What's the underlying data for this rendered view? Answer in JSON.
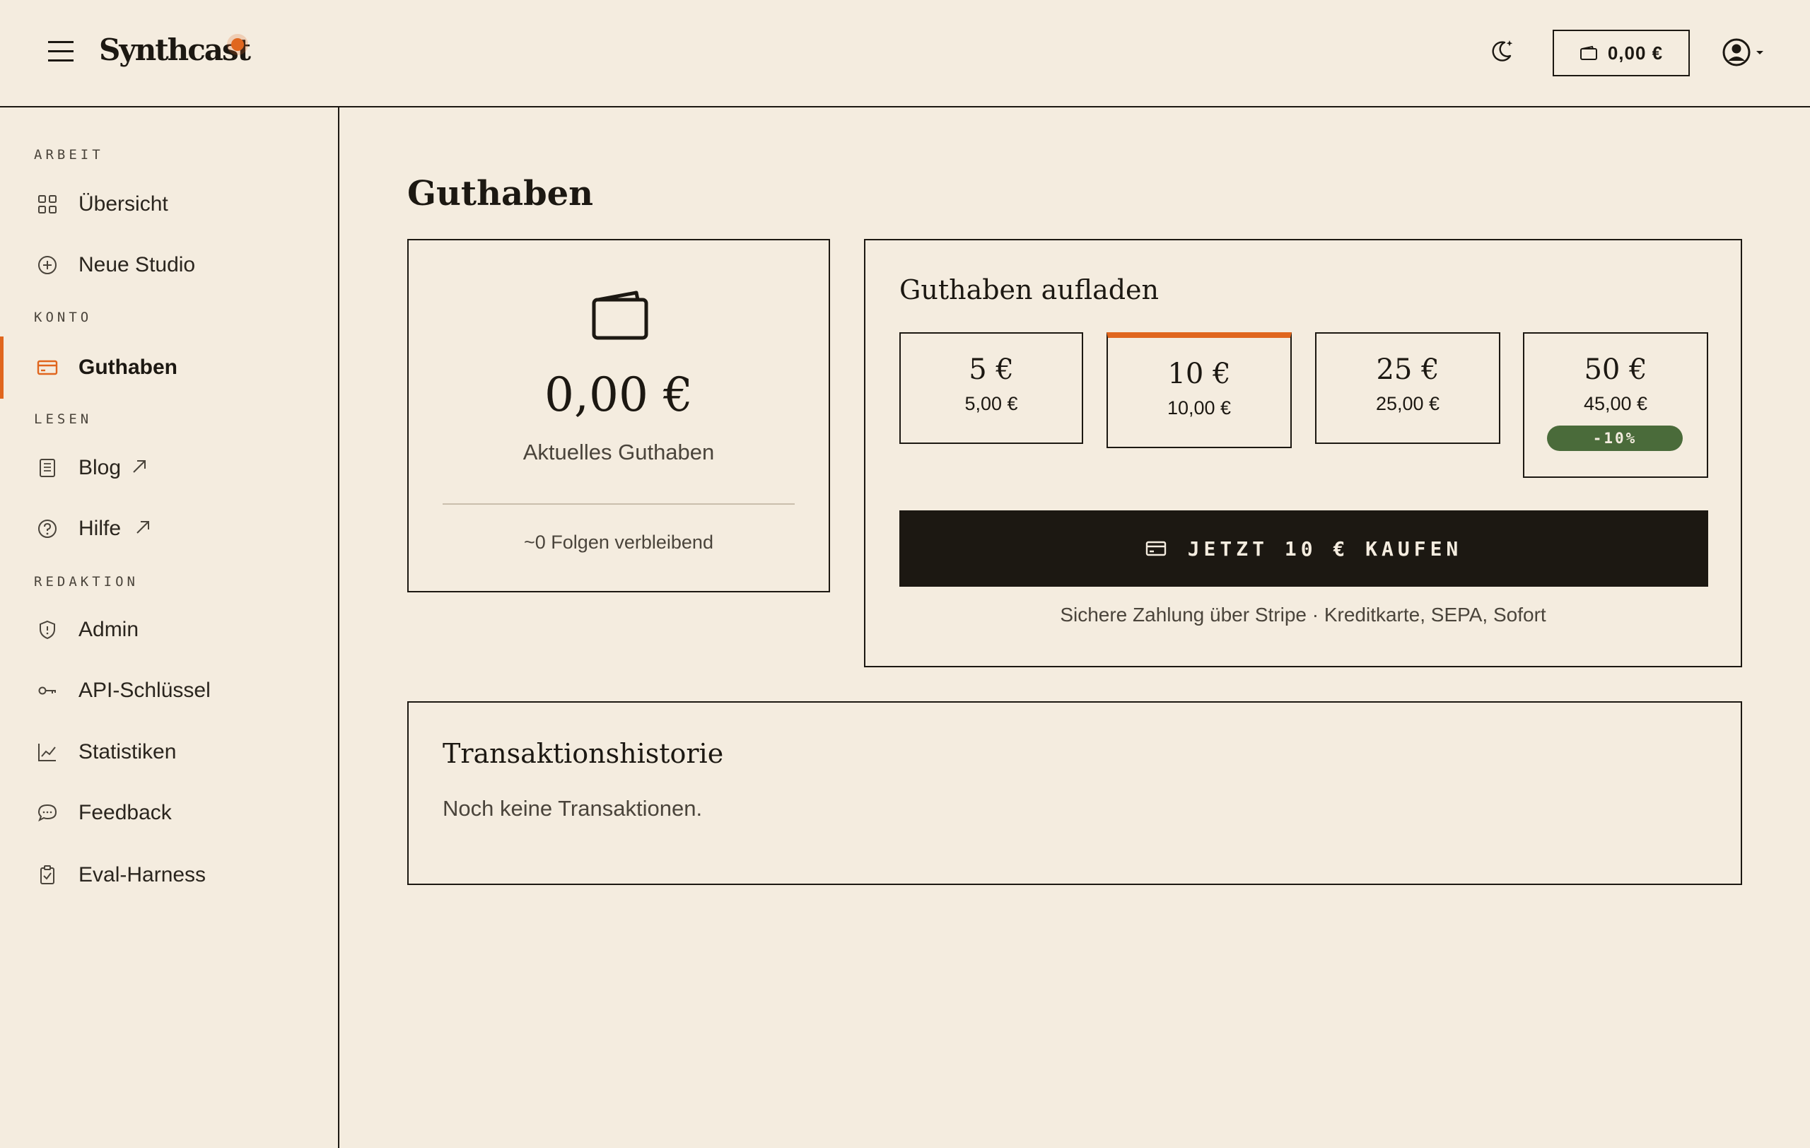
{
  "header": {
    "app_name": "Synthcast",
    "balance": "0,00 €",
    "icons": [
      "menu-icon",
      "moon-icon",
      "wallet-icon",
      "user-circle-icon",
      "chevron-down-icon"
    ]
  },
  "sidebar": {
    "sections": [
      {
        "label": "ARBEIT"
      },
      {
        "label": "KONTO"
      },
      {
        "label": "LESEN"
      },
      {
        "label": "REDAKTION"
      }
    ],
    "items": [
      {
        "label": "Übersicht",
        "icon": "grid-icon"
      },
      {
        "label": "Neue Studio",
        "icon": "plus-circle-icon"
      },
      {
        "label": "Guthaben",
        "icon": "credit-card-icon",
        "active": true
      },
      {
        "label": "Blog",
        "icon": "document-icon",
        "external": true
      },
      {
        "label": "Hilfe",
        "icon": "help-circle-icon",
        "external": true
      },
      {
        "label": "Admin",
        "icon": "shield-icon"
      },
      {
        "label": "API-Schlüssel",
        "icon": "key-icon"
      },
      {
        "label": "Statistiken",
        "icon": "chart-line-icon"
      },
      {
        "label": "Feedback",
        "icon": "chat-bubble-icon"
      },
      {
        "label": "Eval-Harness",
        "icon": "clipboard-check-icon"
      }
    ]
  },
  "main": {
    "title": "Guthaben",
    "balance_card": {
      "amount": "0,00 €",
      "caption": "Aktuelles Guthaben",
      "remaining": "~0 Folgen verbleibend"
    },
    "topup": {
      "title": "Guthaben aufladen",
      "packs": [
        {
          "price": "5 €",
          "net": "5,00 €"
        },
        {
          "price": "10 €",
          "net": "10,00 €",
          "selected": true
        },
        {
          "price": "25 €",
          "net": "25,00 €"
        },
        {
          "price": "50 €",
          "net": "45,00 €",
          "badge": "-10%"
        }
      ],
      "buy_label": "JETZT 10 € KAUFEN",
      "secure_note": "Sichere Zahlung über Stripe · Kreditkarte, SEPA, Sofort"
    },
    "history": {
      "title": "Transaktionshistorie",
      "empty": "Noch keine Transaktionen."
    }
  },
  "colors": {
    "background": "#f4ecdf",
    "ink": "#1c1812",
    "accent": "#e0661e",
    "discount": "#4a6b3a"
  }
}
